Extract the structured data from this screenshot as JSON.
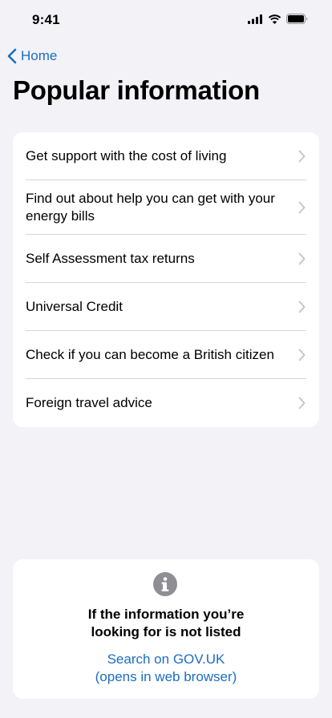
{
  "status_bar": {
    "time": "9:41",
    "icons": [
      "cellular-signal-icon",
      "wifi-icon",
      "battery-icon"
    ]
  },
  "nav": {
    "back_label": "Home",
    "back_icon": "chevron-left-icon"
  },
  "page": {
    "title": "Popular information"
  },
  "list": {
    "items": [
      {
        "label": "Get support with the cost of living"
      },
      {
        "label": "Find out about help you can get with your energy bills"
      },
      {
        "label": "Self Assessment tax returns"
      },
      {
        "label": "Universal Credit"
      },
      {
        "label": "Check if you can become a British citizen"
      },
      {
        "label": "Foreign travel advice"
      }
    ],
    "item_icon": "chevron-right-icon"
  },
  "info_card": {
    "icon": "info-icon",
    "message_line1": "If the information you’re",
    "message_line2": "looking for is not listed",
    "link_line1": "Search on GOV.UK",
    "link_line2": "(opens in web browser)"
  },
  "colors": {
    "background": "#f2f2f7",
    "card": "#ffffff",
    "link": "#1b6ec2",
    "separator": "#d6d6da",
    "chevron": "#c4c4c7",
    "info_icon": "#8e8e93"
  }
}
